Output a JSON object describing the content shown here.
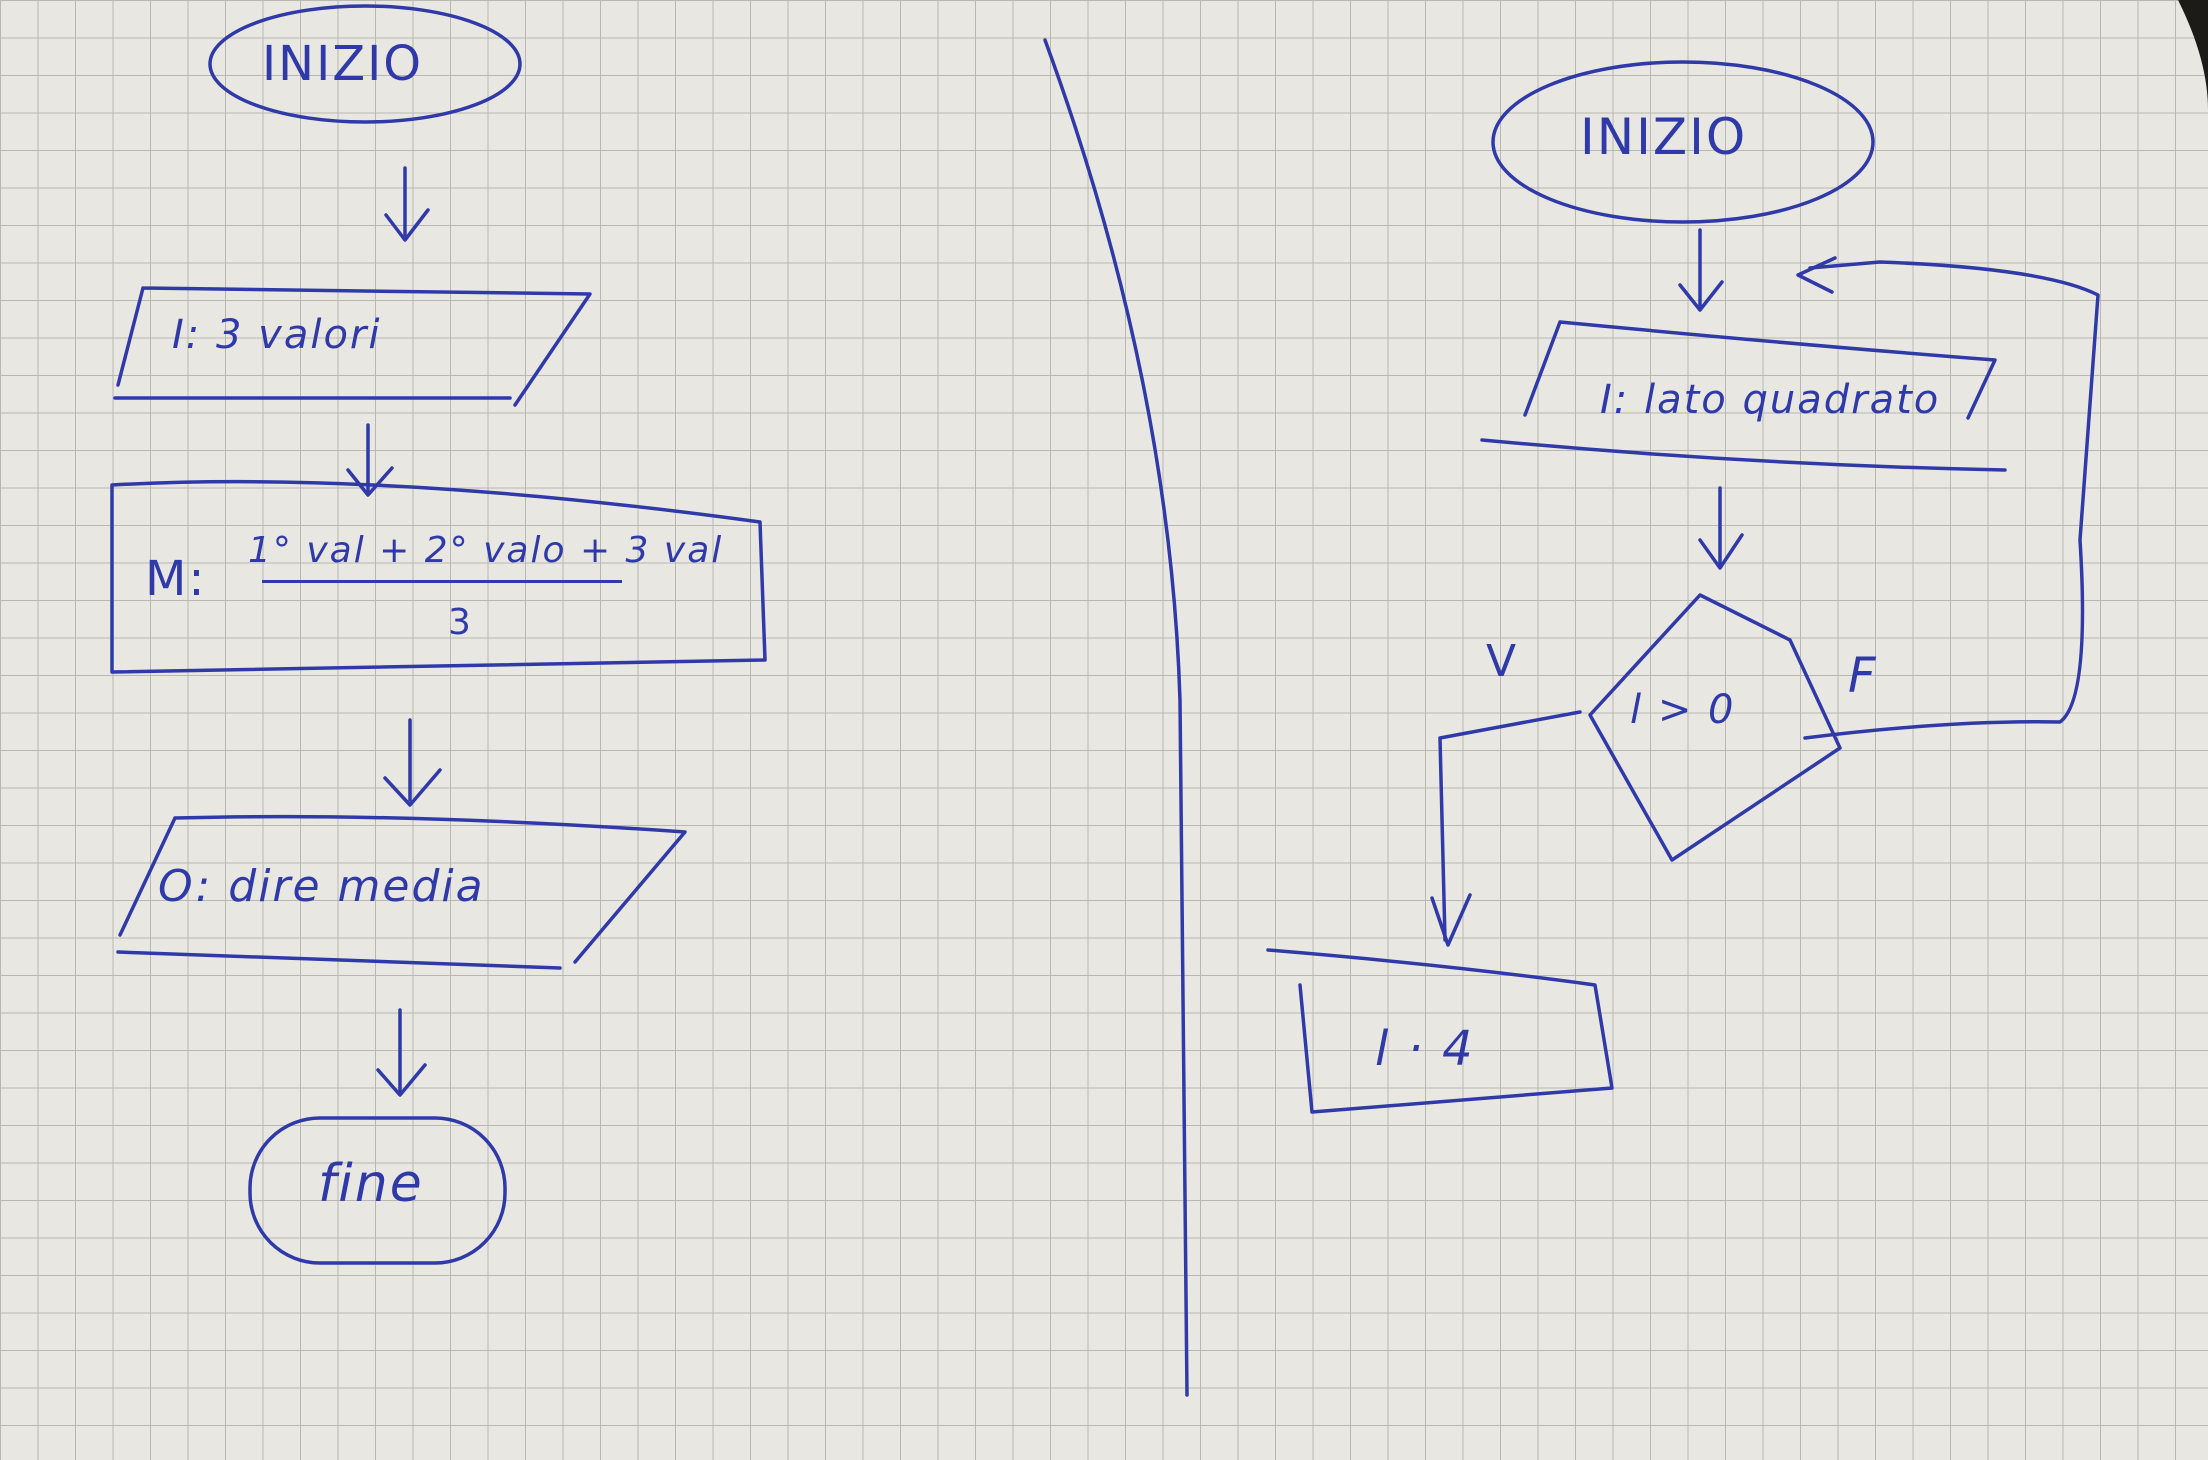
{
  "colors": {
    "paper": "#e9e7e2",
    "grid": "#b9b7b3",
    "ink": "#2f3aa8",
    "background": "#1d1b18"
  },
  "left_flowchart": {
    "start": "INIZIO",
    "input": "I: 3 valori",
    "process_prefix": "M:",
    "process_numerator": "1° val + 2° valo + 3 val",
    "process_denominator": "3",
    "output": "O: dire media",
    "end": "fine"
  },
  "right_flowchart": {
    "start": "INIZIO",
    "input": "I: lato quadrato",
    "decision": "l > 0",
    "true_branch": "V",
    "false_branch": "F",
    "process": "l · 4"
  }
}
